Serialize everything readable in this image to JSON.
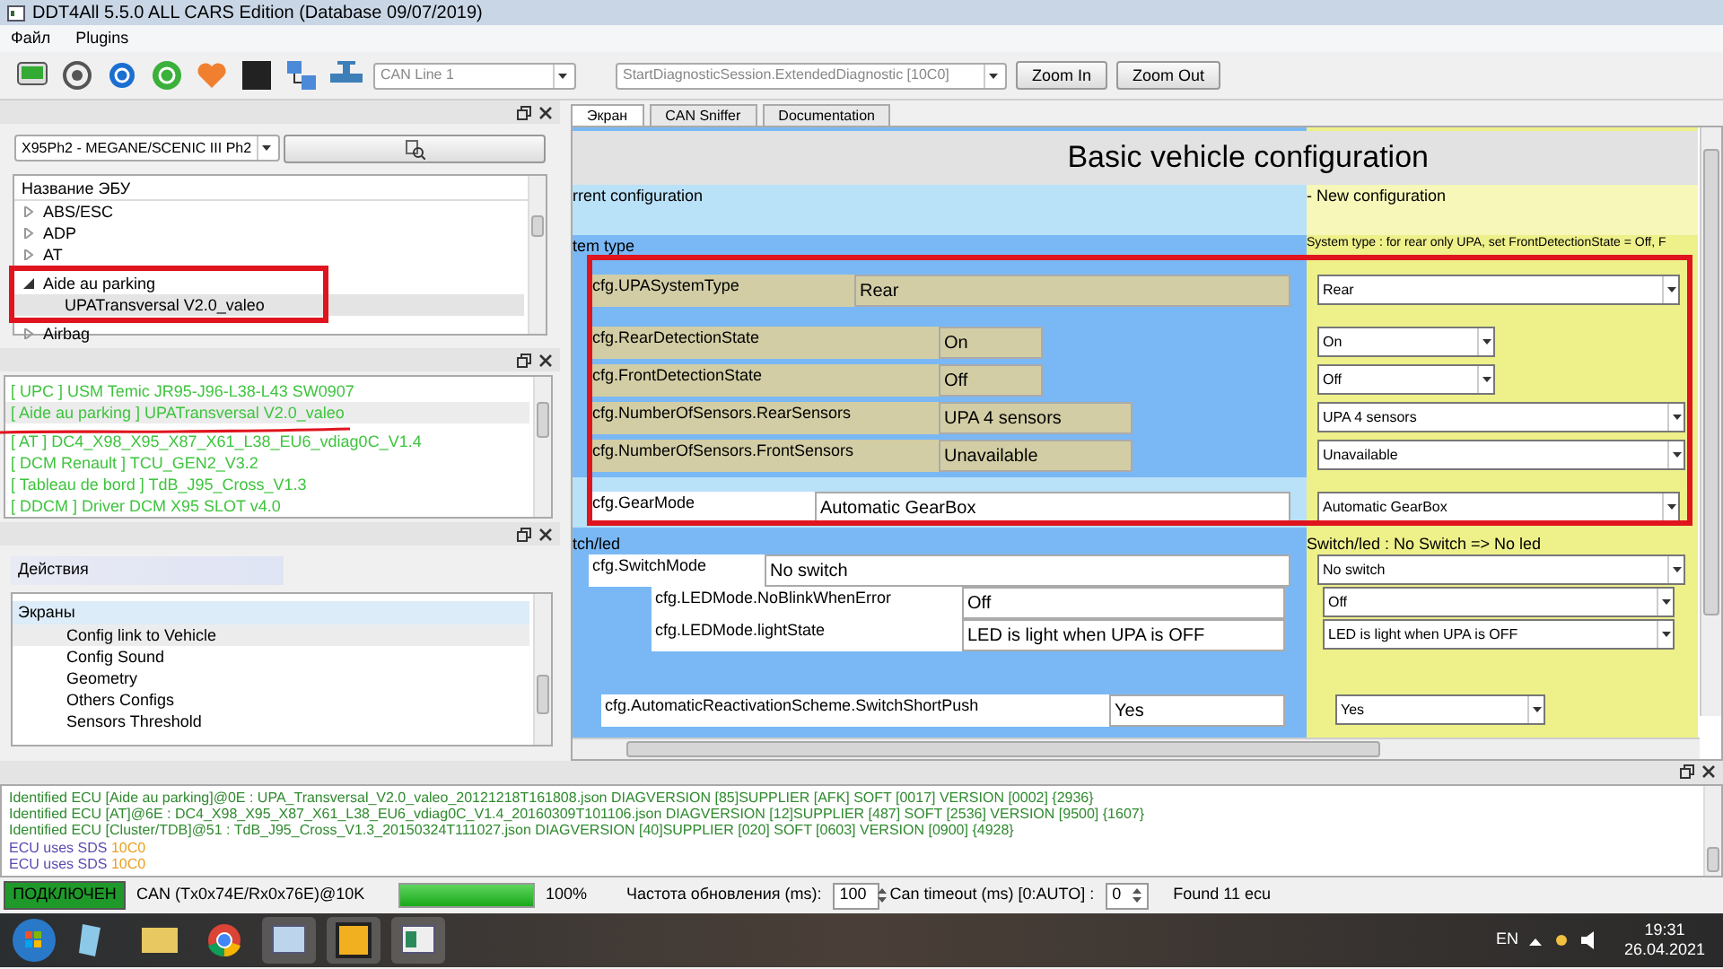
{
  "window": {
    "title": "DDT4All 5.5.0 ALL CARS Edition (Database 09/07/2019)"
  },
  "menu": [
    "Файл",
    "Plugins"
  ],
  "toolbar": {
    "can_line": "CAN Line 1",
    "session": "StartDiagnosticSession.ExtendedDiagnostic [10C0]",
    "buttons": [
      "Zoom In",
      "Zoom Out"
    ]
  },
  "vehicle_select": {
    "value": "X95Ph2 - MEGANE/SCENIC III Ph2"
  },
  "ecu_tree": {
    "header": "Название ЭБУ",
    "items": [
      {
        "label": "ABS/ESC",
        "expanded": false
      },
      {
        "label": "ADP",
        "expanded": false
      },
      {
        "label": "AT",
        "expanded": false
      },
      {
        "label": "Aide au parking",
        "expanded": true,
        "children": [
          {
            "label": "UPATransversal V2.0_valeo",
            "selected": true
          }
        ]
      },
      {
        "label": "Airbag",
        "expanded": false
      }
    ]
  },
  "ecu_list": [
    {
      "label": "[ UPC ] USM Temic JR95-J96-L38-L43 SW0907",
      "selected": false
    },
    {
      "label": "[ Aide au parking ] UPATransversal V2.0_valeo",
      "selected": true
    },
    {
      "label": "[ AT ] DC4_X98_X95_X87_X61_L38_EU6_vdiag0C_V1.4",
      "selected": false
    },
    {
      "label": "[ DCM Renault ] TCU_GEN2_V3.2",
      "selected": false
    },
    {
      "label": "[ Tableau de bord ] TdB_J95_Cross_V1.3",
      "selected": false
    },
    {
      "label": "[ DDCM ] Driver DCM X95 SLOT v4.0",
      "selected": false
    }
  ],
  "actions": {
    "tab": "Действия",
    "group": "Экраны",
    "items": [
      {
        "label": "Config link to Vehicle",
        "selected": true
      },
      {
        "label": "Config Sound",
        "selected": false
      },
      {
        "label": "Geometry",
        "selected": false
      },
      {
        "label": "Others Configs",
        "selected": false
      },
      {
        "label": "Sensors Threshold",
        "selected": false
      }
    ]
  },
  "tabs": [
    {
      "label": "Экран",
      "selected": true
    },
    {
      "label": "CAN Sniffer",
      "selected": false
    },
    {
      "label": "Documentation",
      "selected": false
    }
  ],
  "screen": {
    "title": "Basic vehicle configuration",
    "current_header": "rrent configuration",
    "new_header": "- New configuration",
    "section_1": {
      "left": "tem type",
      "right": "System type : for rear only UPA, set FrontDetectionState = Off, F"
    },
    "section_2": {
      "left": "tch/led",
      "right": "Switch/led : No Switch => No led"
    },
    "fields": [
      {
        "kind": "tan",
        "label": "cfg.UPASystemType",
        "value": "Rear",
        "new_value": "Rear"
      },
      {
        "kind": "tan",
        "label": "cfg.RearDetectionState",
        "value": "On",
        "new_value": "On"
      },
      {
        "kind": "tan",
        "label": "cfg.FrontDetectionState",
        "value": "Off",
        "new_value": "Off"
      },
      {
        "kind": "tan",
        "label": "cfg.NumberOfSensors.RearSensors",
        "value": "UPA 4 sensors",
        "new_value": "UPA 4 sensors"
      },
      {
        "kind": "tan",
        "label": "cfg.NumberOfSensors.FrontSensors",
        "value": "Unavailable",
        "new_value": "Unavailable"
      },
      {
        "kind": "white",
        "label": "cfg.GearMode",
        "value": "Automatic GearBox",
        "new_value": "Automatic GearBox"
      },
      {
        "kind": "white",
        "label": "cfg.SwitchMode",
        "value": "No switch",
        "new_value": "No switch"
      },
      {
        "kind": "white",
        "label": "cfg.LEDMode.NoBlinkWhenError",
        "value": "Off",
        "new_value": "Off"
      },
      {
        "kind": "white",
        "label": "cfg.LEDMode.lightState",
        "value": "LED is light when UPA is OFF",
        "new_value": "LED is light when UPA is OFF"
      },
      {
        "kind": "white",
        "label": "cfg.AutomaticReactivationScheme.SwitchShortPush",
        "value": "Yes",
        "new_value": "Yes"
      }
    ]
  },
  "log": [
    {
      "kind": "info",
      "text": "Identified ECU [Aide au parking]@0E : UPA_Transversal_V2.0_valeo_20121218T161808.json DIAGVERSION [85]SUPPLIER [AFK] SOFT [0017] VERSION [0002] {2936}"
    },
    {
      "kind": "info",
      "text": "Identified ECU [AT]@6E : DC4_X98_X95_X87_X61_L38_EU6_vdiag0C_V1.4_20160309T101106.json DIAGVERSION [12]SUPPLIER [487] SOFT [2536] VERSION [9500] {1607}"
    },
    {
      "kind": "info",
      "text": "Identified ECU [Cluster/TDB]@51 : TdB_J95_Cross_V1.3_20150324T111027.json DIAGVERSION [40]SUPPLIER [020] SOFT [0603] VERSION [0900] {4928}"
    },
    {
      "kind": "sds",
      "text": "ECU uses SDS",
      "code": "10C0"
    },
    {
      "kind": "sds",
      "text": "ECU uses SDS",
      "code": "10C0"
    }
  ],
  "status": {
    "connection": "ПОДКЛЮЧЕН",
    "connected": true,
    "can": "CAN (Tx0x74E/Rx0x76E)@10K",
    "progress": {
      "level": 1
    },
    "percent": "100%",
    "refresh_label": "Частота обновления (ms):",
    "refresh_value": "100",
    "timeout_label": "Can timeout (ms) [0:AUTO] :",
    "timeout_value": "0",
    "found": "Found 11 ecu"
  },
  "taskbar": {
    "language": "EN",
    "time": "19:31",
    "date": "26.04.2021"
  }
}
